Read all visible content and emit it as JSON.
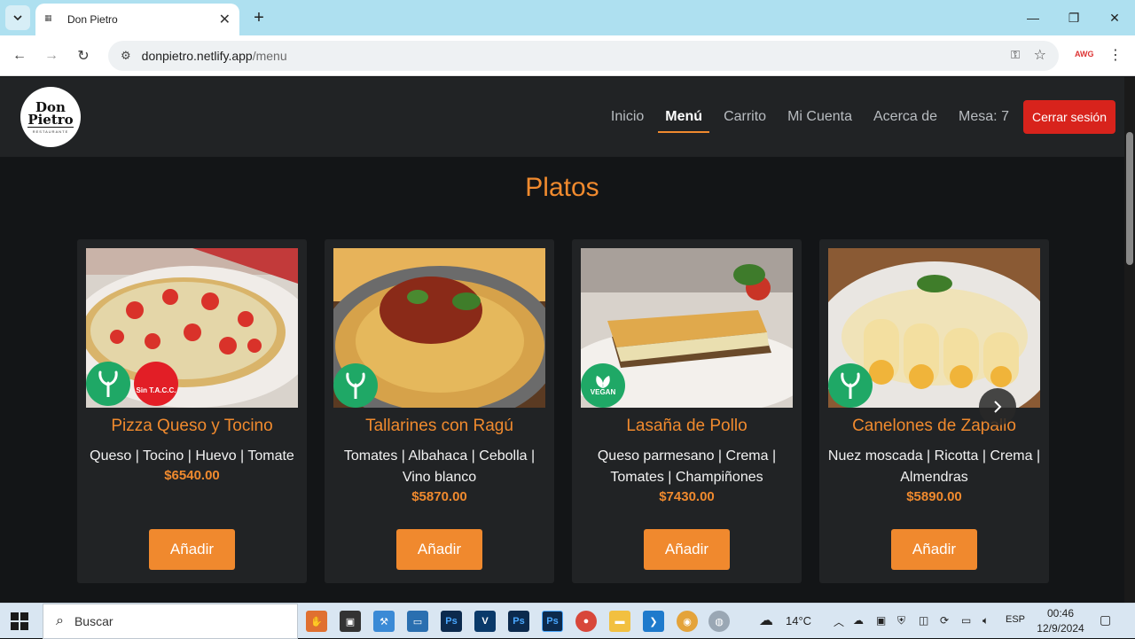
{
  "browser": {
    "tab_title": "Don Pietro",
    "url_host": "donpietro.netlify.app",
    "url_path": "/menu",
    "ext_label": "AWG"
  },
  "site": {
    "logo_line1": "Don",
    "logo_line2": "Pietro",
    "logo_sub": "RESTAURANTE",
    "nav": {
      "inicio": "Inicio",
      "menu": "Menú",
      "carrito": "Carrito",
      "cuenta": "Mi Cuenta",
      "acerca": "Acerca de",
      "mesa": "Mesa: 7",
      "logout": "Cerrar sesión"
    },
    "section_title": "Platos"
  },
  "dishes": [
    {
      "name": "Pizza Queso y Tocino",
      "ingredients": "Queso | Tocino | Huevo | Tomate",
      "price": "$6540.00",
      "button": "Añadir",
      "badges": [
        "vegetarian-icon",
        "gluten-free-icon"
      ],
      "gf_label": "Sin T.A.C.C."
    },
    {
      "name": "Tallarines con Ragú",
      "ingredients": "Tomates | Albahaca | Cebolla | Vino blanco",
      "price": "$5870.00",
      "button": "Añadir",
      "badges": [
        "vegetarian-icon"
      ]
    },
    {
      "name": "Lasaña de Pollo",
      "ingredients": "Queso parmesano | Crema | Tomates | Champiñones",
      "price": "$7430.00",
      "button": "Añadir",
      "badges": [
        "vegan-icon"
      ],
      "vegan_label": "VEGAN"
    },
    {
      "name": "Canelones de Zapallo",
      "ingredients": "Nuez moscada | Ricotta | Crema | Almendras",
      "price": "$5890.00",
      "button": "Añadir",
      "badges": [
        "vegetarian-icon"
      ]
    }
  ],
  "taskbar": {
    "search_placeholder": "Buscar",
    "weather": "14°C",
    "lang": "ESP",
    "time": "00:46",
    "date": "12/9/2024"
  },
  "colors": {
    "accent": "#f08a2e",
    "logout": "#d8231c",
    "badge_green": "#1fa866"
  }
}
